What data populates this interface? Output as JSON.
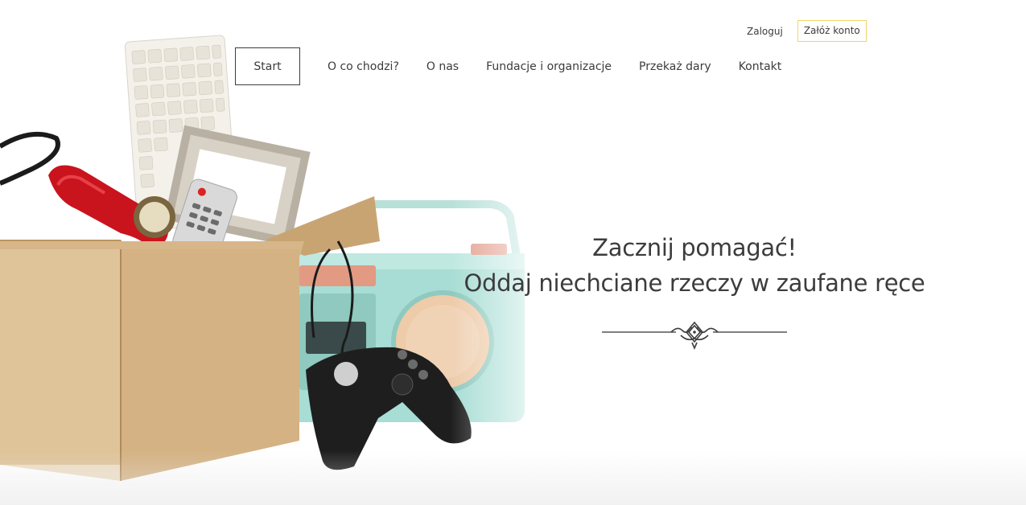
{
  "header": {
    "login_label": "Zaloguj",
    "register_label": "Załóż konto"
  },
  "nav": {
    "items": [
      {
        "label": "Start",
        "active": true
      },
      {
        "label": "O co chodzi?",
        "active": false
      },
      {
        "label": "O nas",
        "active": false
      },
      {
        "label": "Fundacje i organizacje",
        "active": false
      },
      {
        "label": "Przekaż dary",
        "active": false
      },
      {
        "label": "Kontakt",
        "active": false
      }
    ]
  },
  "hero": {
    "title": "Zacznij pomagać!",
    "subtitle": "Oddaj niechciane rzeczy w zaufane ręce",
    "decoration_icon": "ornament-divider-icon"
  },
  "colors": {
    "text": "#3c3c3c",
    "accent_border": "#f1d468",
    "background": "#ffffff"
  }
}
